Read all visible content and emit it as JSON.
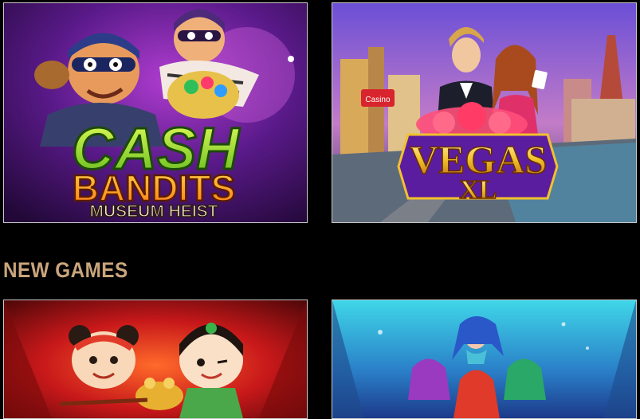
{
  "games": {
    "cash_bandits": {
      "line1": "CASH",
      "line2": "BANDITS",
      "line3": "MUSEUM HEIST"
    },
    "vegas_xl": {
      "line1": "VEGAS",
      "line2": "XL",
      "sign": "Casino"
    }
  },
  "sections": {
    "new_games_title": "NEW GAMES"
  },
  "colors": {
    "background": "#000000",
    "section_title": "#c9a57c",
    "tile_border": "#c9c9c9"
  }
}
